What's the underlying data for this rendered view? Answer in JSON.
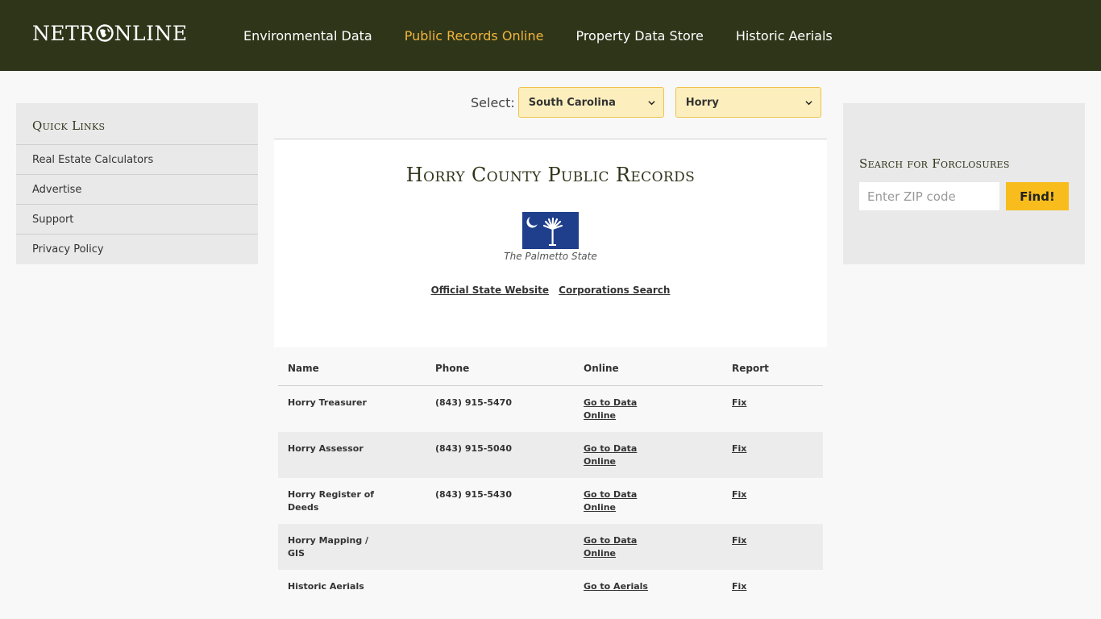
{
  "header": {
    "logo_left": "NETR",
    "logo_right": "NLINE",
    "nav": [
      {
        "label": "Environmental Data",
        "active": false
      },
      {
        "label": "Public Records Online",
        "active": true
      },
      {
        "label": "Property Data Store",
        "active": false
      },
      {
        "label": "Historic Aerials",
        "active": false
      }
    ],
    "colors": {
      "bar": "#2f3519",
      "active": "#f0b43c"
    }
  },
  "quick_links": {
    "title": "Quick Links",
    "items": [
      "Real Estate Calculators",
      "Advertise",
      "Support",
      "Privacy Policy"
    ]
  },
  "select": {
    "label": "Select:",
    "state": "South Carolina",
    "county": "Horry"
  },
  "county": {
    "title": "Horry County Public Records",
    "flag_icon": "south-carolina-flag-icon",
    "nickname": "The Palmetto State",
    "links": [
      "Official State Website",
      "Corporations Search"
    ]
  },
  "table": {
    "headers": [
      "Name",
      "Phone",
      "Online",
      "Report"
    ],
    "rows": [
      {
        "name": "Horry Treasurer",
        "phone": "(843) 915-5470",
        "online": "Go to Data Online",
        "report": "Fix"
      },
      {
        "name": "Horry Assessor",
        "phone": "(843) 915-5040",
        "online": "Go to Data Online",
        "report": "Fix"
      },
      {
        "name": "Horry Register of Deeds",
        "phone": "(843) 915-5430",
        "online": "Go to Data Online",
        "report": "Fix"
      },
      {
        "name": "Horry Mapping / GIS",
        "phone": "",
        "online": "Go to Data Online",
        "report": "Fix"
      },
      {
        "name": "Historic Aerials",
        "phone": "",
        "online": "Go to Aerials",
        "report": "Fix"
      }
    ]
  },
  "foreclosure": {
    "title": "Search for Forclosures",
    "zip_placeholder": "Enter ZIP code",
    "button": "Find!"
  }
}
